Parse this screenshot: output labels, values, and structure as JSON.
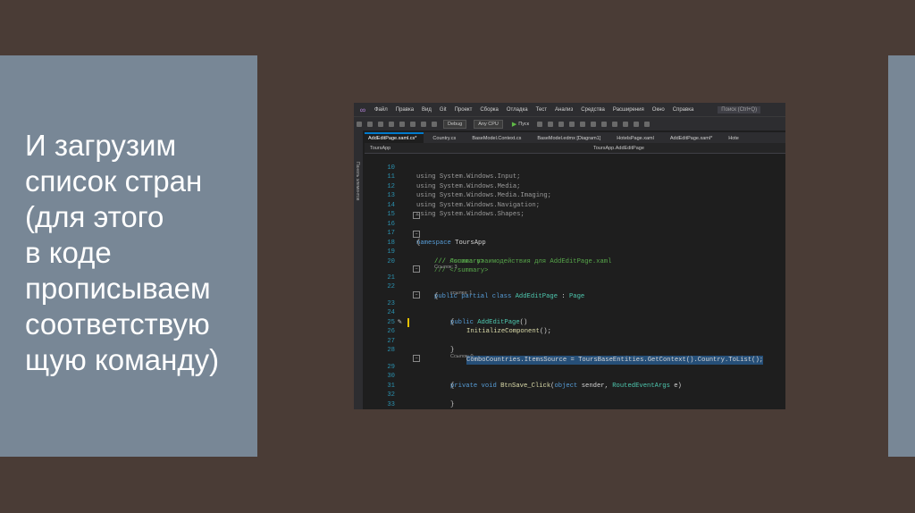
{
  "slide": {
    "text_lines": [
      "И загрузим",
      "список стран",
      "(для этого",
      "в коде",
      "прописываем",
      "соответствую",
      "щую команду)"
    ]
  },
  "ide": {
    "menu": [
      "Файл",
      "Правка",
      "Вид",
      "Git",
      "Проект",
      "Сборка",
      "Отладка",
      "Тест",
      "Анализ",
      "Средства",
      "Расширения",
      "Окно",
      "Справка"
    ],
    "search_placeholder": "Поиск (Ctrl+Q)",
    "toolbar": {
      "config": "Debug",
      "platform": "Any CPU",
      "run_label": "Пуск"
    },
    "sidebar_label": "Панель элементов",
    "tabs": [
      "AddEditPage.xaml.cs*",
      "Country.cs",
      "BaseModel.Context.cs",
      "BaseModel.edmx [Diagram1]",
      "HotelsPage.xaml",
      "AddEditPage.xaml*",
      "Hote"
    ],
    "nav": {
      "project": "ToursApp",
      "member": "ToursApp.AddEditPage"
    },
    "code": {
      "l10": {
        "num": "10",
        "kw": "using",
        "rest": " System.Windows.Input;"
      },
      "l11": {
        "num": "11",
        "kw": "using",
        "rest": " System.Windows.Media;"
      },
      "l12": {
        "num": "12",
        "kw": "using",
        "rest": " System.Windows.Media.Imaging;"
      },
      "l13": {
        "num": "13",
        "kw": "using",
        "rest": " System.Windows.Navigation;"
      },
      "l14": {
        "num": "14",
        "kw": "using",
        "rest": " System.Windows.Shapes;"
      },
      "l15": {
        "num": "15"
      },
      "l16": {
        "num": "16",
        "kw": "namespace",
        "rest": " ToursApp"
      },
      "l17": {
        "num": "17",
        "text": "{"
      },
      "l18": {
        "num": "18",
        "text": "/// <summary>"
      },
      "l19": {
        "num": "19",
        "text": "/// Логика взаимодействия для AddEditPage.xaml"
      },
      "l20": {
        "num": "20",
        "text": "/// </summary>"
      },
      "hint20": "Ссылок: 3",
      "l21": {
        "num": "21",
        "kw": "public partial class",
        "name": " AddEditPage",
        "sep": " : ",
        "base": "Page"
      },
      "l22": {
        "num": "22",
        "text": "{"
      },
      "hint22": "ссылка: 1",
      "l23": {
        "num": "23",
        "kw": "public",
        "name": " AddEditPage",
        "rest": "()"
      },
      "l24": {
        "num": "24",
        "text": "{"
      },
      "l25": {
        "num": "25",
        "fn": "InitializeComponent",
        "rest": "();"
      },
      "l26": {
        "num": "26",
        "text": "ComboCountries.ItemsSource = ToursBaseEntities.GetContext().Country.ToList();"
      },
      "l27": {
        "num": "27",
        "text": "}"
      },
      "l28": {
        "num": "28"
      },
      "hint28": "Ссылок: 0",
      "l29": {
        "num": "29",
        "kw": "private void",
        "fn": " BtnSave_Click",
        "p1": "(",
        "k2": "object",
        "p2": " sender, ",
        "t2": "RoutedEventArgs",
        "p3": " e)"
      },
      "l30": {
        "num": "30",
        "text": "{"
      },
      "l31": {
        "num": "31"
      },
      "l32": {
        "num": "32",
        "text": "}"
      },
      "l33": {
        "num": "33",
        "text": "}"
      },
      "l34": {
        "num": "34",
        "text": "}"
      }
    }
  }
}
